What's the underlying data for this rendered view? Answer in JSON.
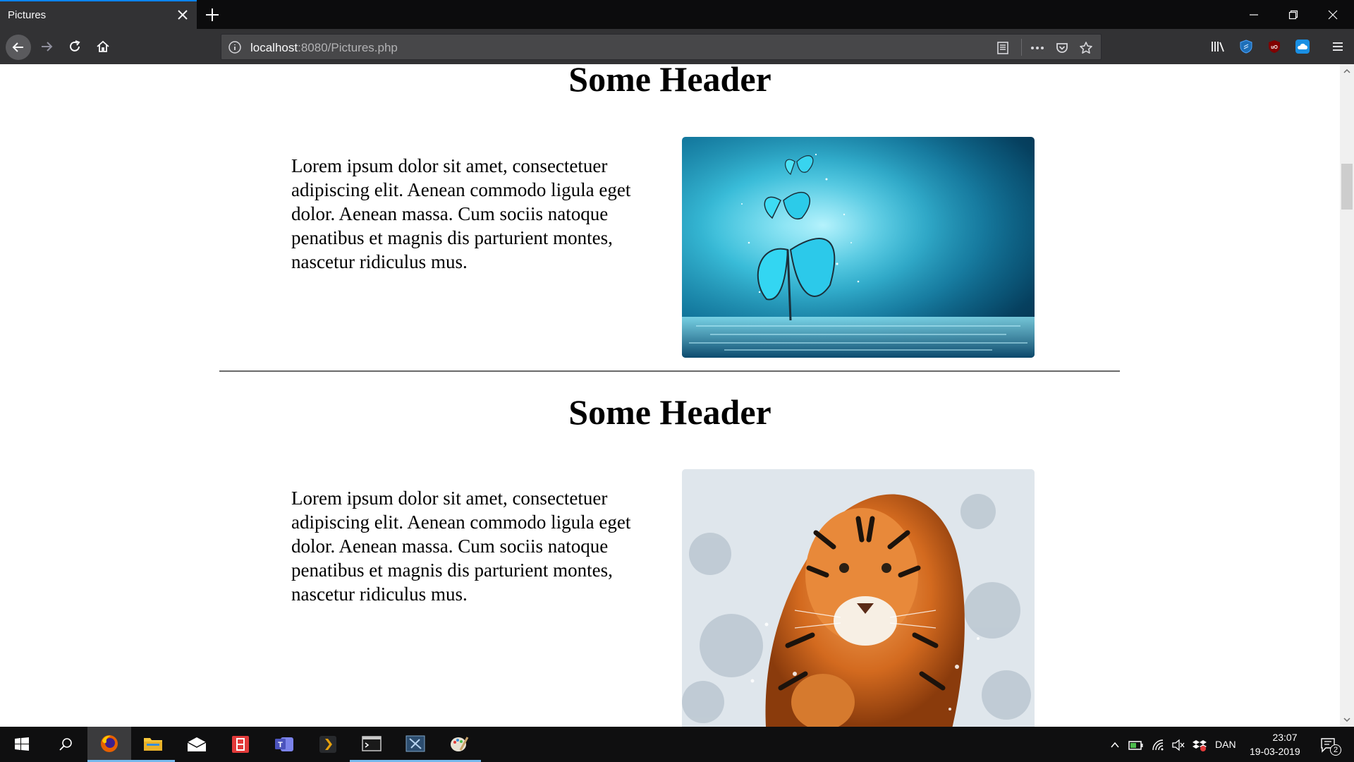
{
  "browser": {
    "tab_title": "Pictures",
    "url_host": "localhost",
    "url_rest": ":8080/Pictures.php"
  },
  "page": {
    "sections": [
      {
        "heading": "Some Header",
        "text": "Lorem ipsum dolor sit amet, consectetuer adipiscing elit. Aenean commodo ligula eget dolor. Aenean massa. Cum sociis natoque penatibus et magnis dis parturient montes, nascetur ridiculus mus.",
        "image": "butterflies-picture"
      },
      {
        "heading": "Some Header",
        "text": "Lorem ipsum dolor sit amet, consectetuer adipiscing elit. Aenean commodo ligula eget dolor. Aenean massa. Cum sociis natoque penatibus et magnis dis parturient montes, nascetur ridiculus mus.",
        "image": "tiger-picture"
      }
    ]
  },
  "taskbar": {
    "language": "DAN",
    "time": "23:07",
    "date": "19-03-2019",
    "notification_count": "2",
    "apps": [
      "windows-start",
      "search",
      "firefox",
      "file-explorer",
      "mail",
      "media-app",
      "teams",
      "plex",
      "terminal",
      "visual-studio",
      "paint"
    ]
  },
  "colors": {
    "accent": "#0a84ff",
    "chrome_dark": "#0c0c0d",
    "toolbar": "#323234"
  }
}
